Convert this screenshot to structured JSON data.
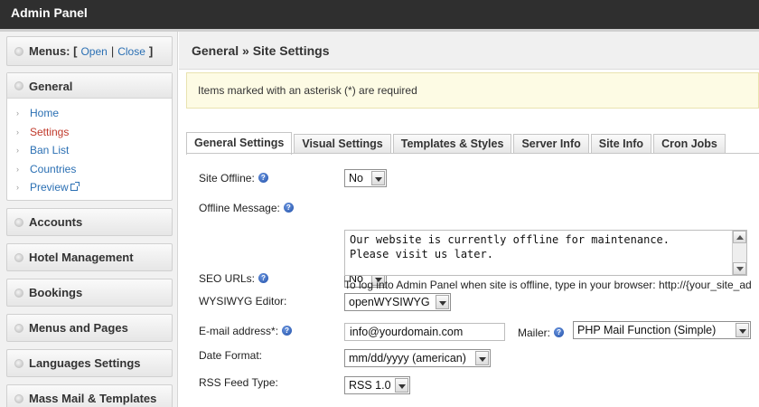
{
  "topbar": {
    "title": "Admin Panel"
  },
  "sidebar": {
    "menus_label": "Menus: [",
    "open_label": "Open",
    "separator": "|",
    "close_label": "Close",
    "menus_end": "]",
    "general": {
      "title": "General",
      "items": [
        {
          "label": "Home",
          "active": false
        },
        {
          "label": "Settings",
          "active": true
        },
        {
          "label": "Ban List",
          "active": false
        },
        {
          "label": "Countries",
          "active": false
        },
        {
          "label": "Preview",
          "active": false,
          "external": true
        }
      ]
    },
    "sections": [
      "Accounts",
      "Hotel Management",
      "Bookings",
      "Menus and Pages",
      "Languages Settings",
      "Mass Mail & Templates"
    ]
  },
  "main": {
    "title": "General » Site Settings",
    "notice": "Items marked with an asterisk (*) are required",
    "tabs": [
      "General Settings",
      "Visual Settings",
      "Templates & Styles",
      "Server Info",
      "Site Info",
      "Cron Jobs"
    ],
    "active_tab": 0,
    "form": {
      "site_offline": {
        "label": "Site Offline:",
        "value": "No"
      },
      "offline_message": {
        "label": "Offline Message:",
        "value": "Our website is currently offline for maintenance.\nPlease visit us later."
      },
      "hint": "To log into Admin Panel when site is offline, type in your browser: http://{your_site_ad",
      "seo_urls": {
        "label": "SEO URLs:",
        "value": "No"
      },
      "wysiwyg": {
        "label": "WYSIWYG Editor:",
        "value": "openWYSIWYG"
      },
      "email": {
        "label": "E-mail address",
        "asterisk": "*:",
        "value": "info@yourdomain.com"
      },
      "mailer": {
        "label": "Mailer:",
        "value": "PHP Mail Function (Simple)"
      },
      "date_format": {
        "label": "Date Format:",
        "value": "mm/dd/yyyy (american)"
      },
      "rss_feed": {
        "label": "RSS Feed Type:",
        "value": "RSS 1.0"
      }
    }
  },
  "colors": {
    "topbar": "#2f2f2f",
    "link": "#2a6fb3",
    "active_link": "#c0392b",
    "notice_bg": "#fdfbe4"
  },
  "icons": {
    "help": "help-icon",
    "bullet": "bullet-icon",
    "arrow": "arrow-icon",
    "external": "external-link-icon"
  }
}
